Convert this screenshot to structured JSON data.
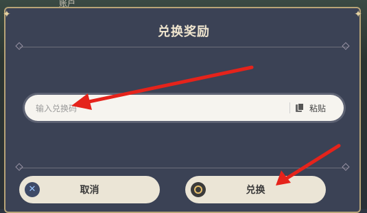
{
  "background": {
    "top_tab_label": "账户"
  },
  "dialog": {
    "title": "兑换奖励",
    "code_input": {
      "placeholder": "输入兑换码",
      "value": ""
    },
    "paste_button": {
      "label": "粘贴",
      "icon": "paste-icon"
    },
    "cancel_button": {
      "label": "取消",
      "icon": "x-circle-icon"
    },
    "redeem_button": {
      "label": "兑换",
      "icon": "circle-icon"
    }
  },
  "annotations": {
    "arrow_color": "#e5231b"
  },
  "colors": {
    "dialog_bg": "#3b4255",
    "border_gold": "#b9a578",
    "button_bg": "#ebe5d6"
  }
}
